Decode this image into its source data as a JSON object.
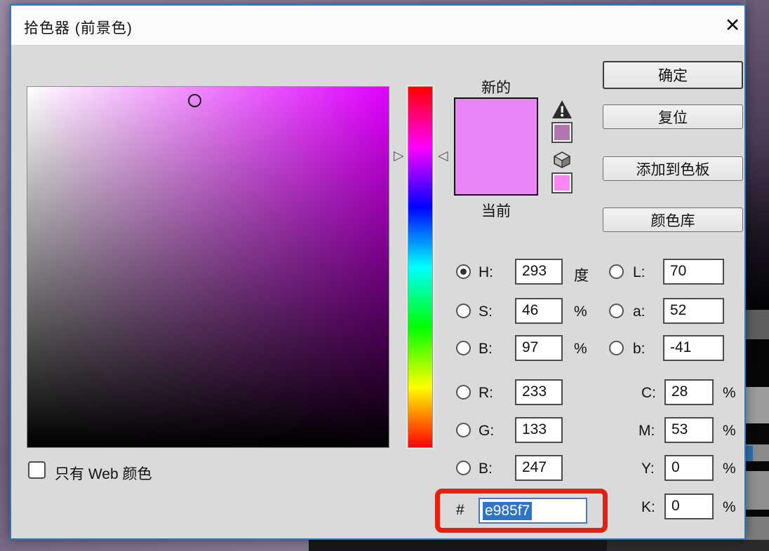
{
  "window": {
    "title": "拾色器 (前景色)",
    "close_glyph": "✕"
  },
  "labels": {
    "new": "新的",
    "current": "当前",
    "web_only": "只有 Web 颜色",
    "hash": "#"
  },
  "buttons": {
    "ok": "确定",
    "reset": "复位",
    "add_to_swatches": "添加到色板",
    "color_libraries": "颜色库"
  },
  "fields": {
    "h": {
      "label": "H:",
      "value": "293",
      "unit": "度",
      "selected": true
    },
    "s": {
      "label": "S:",
      "value": "46",
      "unit": "%"
    },
    "b": {
      "label": "B:",
      "value": "97",
      "unit": "%"
    },
    "r": {
      "label": "R:",
      "value": "233"
    },
    "g": {
      "label": "G:",
      "value": "133"
    },
    "b2": {
      "label": "B:",
      "value": "247"
    },
    "l": {
      "label": "L:",
      "value": "70"
    },
    "a": {
      "label": "a:",
      "value": "52"
    },
    "lab_b": {
      "label": "b:",
      "value": "-41"
    },
    "c": {
      "label": "C:",
      "value": "28",
      "unit": "%"
    },
    "m": {
      "label": "M:",
      "value": "53",
      "unit": "%"
    },
    "y": {
      "label": "Y:",
      "value": "0",
      "unit": "%"
    },
    "k": {
      "label": "K:",
      "value": "0",
      "unit": "%"
    }
  },
  "hex": {
    "value": "e985f7"
  },
  "colors": {
    "new_color": "#e985f7",
    "current_color": "#e985f7",
    "gamut_warning_swatch": "#b176ad",
    "web_safe_swatch": "#f988f0",
    "hue_degrees": 293,
    "annotation_red": "#e6200e",
    "dialog_border_blue": "#2779c6",
    "selection_highlight": "#2e74c8"
  },
  "icons": {
    "hue_arrow_left": "▷",
    "hue_arrow_right": "◁"
  },
  "styles": {
    "new_swatch": "background:#e985f7",
    "current_swatch": "background:#e985f7",
    "gamut_swatch": "background:#b176ad",
    "web_swatch": "background:#f988f0"
  }
}
